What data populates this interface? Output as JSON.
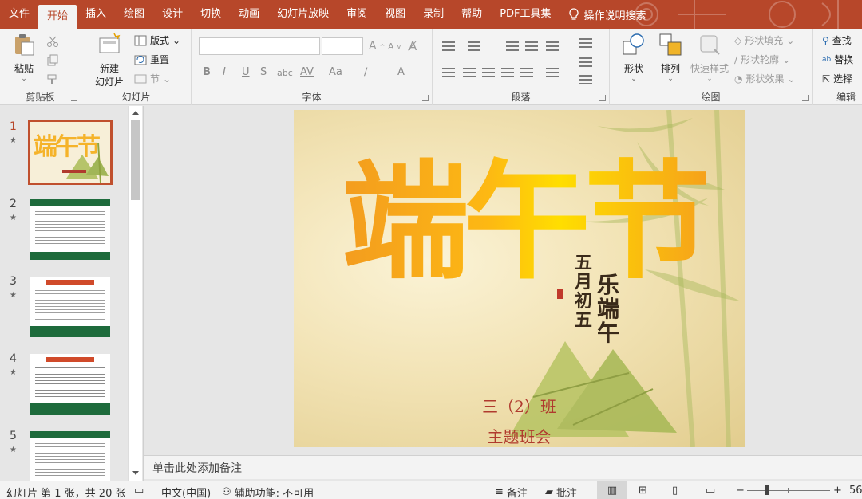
{
  "tabs": [
    "文件",
    "开始",
    "插入",
    "绘图",
    "设计",
    "切换",
    "动画",
    "幻灯片放映",
    "审阅",
    "视图",
    "录制",
    "帮助",
    "PDF工具集"
  ],
  "active_tab": "开始",
  "tell_me": "操作说明搜索",
  "ribbon": {
    "clipboard": {
      "paste": "粘贴",
      "label": "剪贴板"
    },
    "slides": {
      "new_slide_line1": "新建",
      "new_slide_line2": "幻灯片",
      "layout": "版式",
      "reset": "重置",
      "section": "节",
      "label": "幻灯片"
    },
    "font": {
      "label": "字体",
      "bold": "B",
      "italic": "I",
      "underline": "U",
      "strike": "S",
      "abc": "abc",
      "spacing": "AV",
      "case": "Aa"
    },
    "paragraph": {
      "label": "段落"
    },
    "drawing": {
      "shapes": "形状",
      "arrange": "排列",
      "quick_styles": "快速样式",
      "fill": "形状填充",
      "outline": "形状轮廓",
      "effects": "形状效果",
      "label": "绘图"
    },
    "editing": {
      "find": "查找",
      "replace": "替换",
      "select": "选择",
      "label": "编辑"
    }
  },
  "thumbnails": [
    {
      "num": "1",
      "star": "★"
    },
    {
      "num": "2",
      "star": "★"
    },
    {
      "num": "3",
      "star": "★"
    },
    {
      "num": "4",
      "star": "★"
    },
    {
      "num": "5",
      "star": "★"
    }
  ],
  "slide": {
    "title": "端午节",
    "calligraphy_small": "五月初五",
    "calligraphy_big": "乐端午",
    "subtitle_line1": "三（2）班",
    "subtitle_line2": "主题班会"
  },
  "notes_placeholder": "单击此处添加备注",
  "status": {
    "slide_info": "幻灯片 第 1 张，共 20 张",
    "language": "中文(中国)",
    "accessibility": "辅助功能: 不可用",
    "notes": "备注",
    "comments": "批注",
    "zoom": "56"
  },
  "colors": {
    "accent": "#b7472a",
    "title_gradient_start": "#f39c1f",
    "title_gradient_end": "#ffde00",
    "subtitle": "#b03a2e"
  }
}
